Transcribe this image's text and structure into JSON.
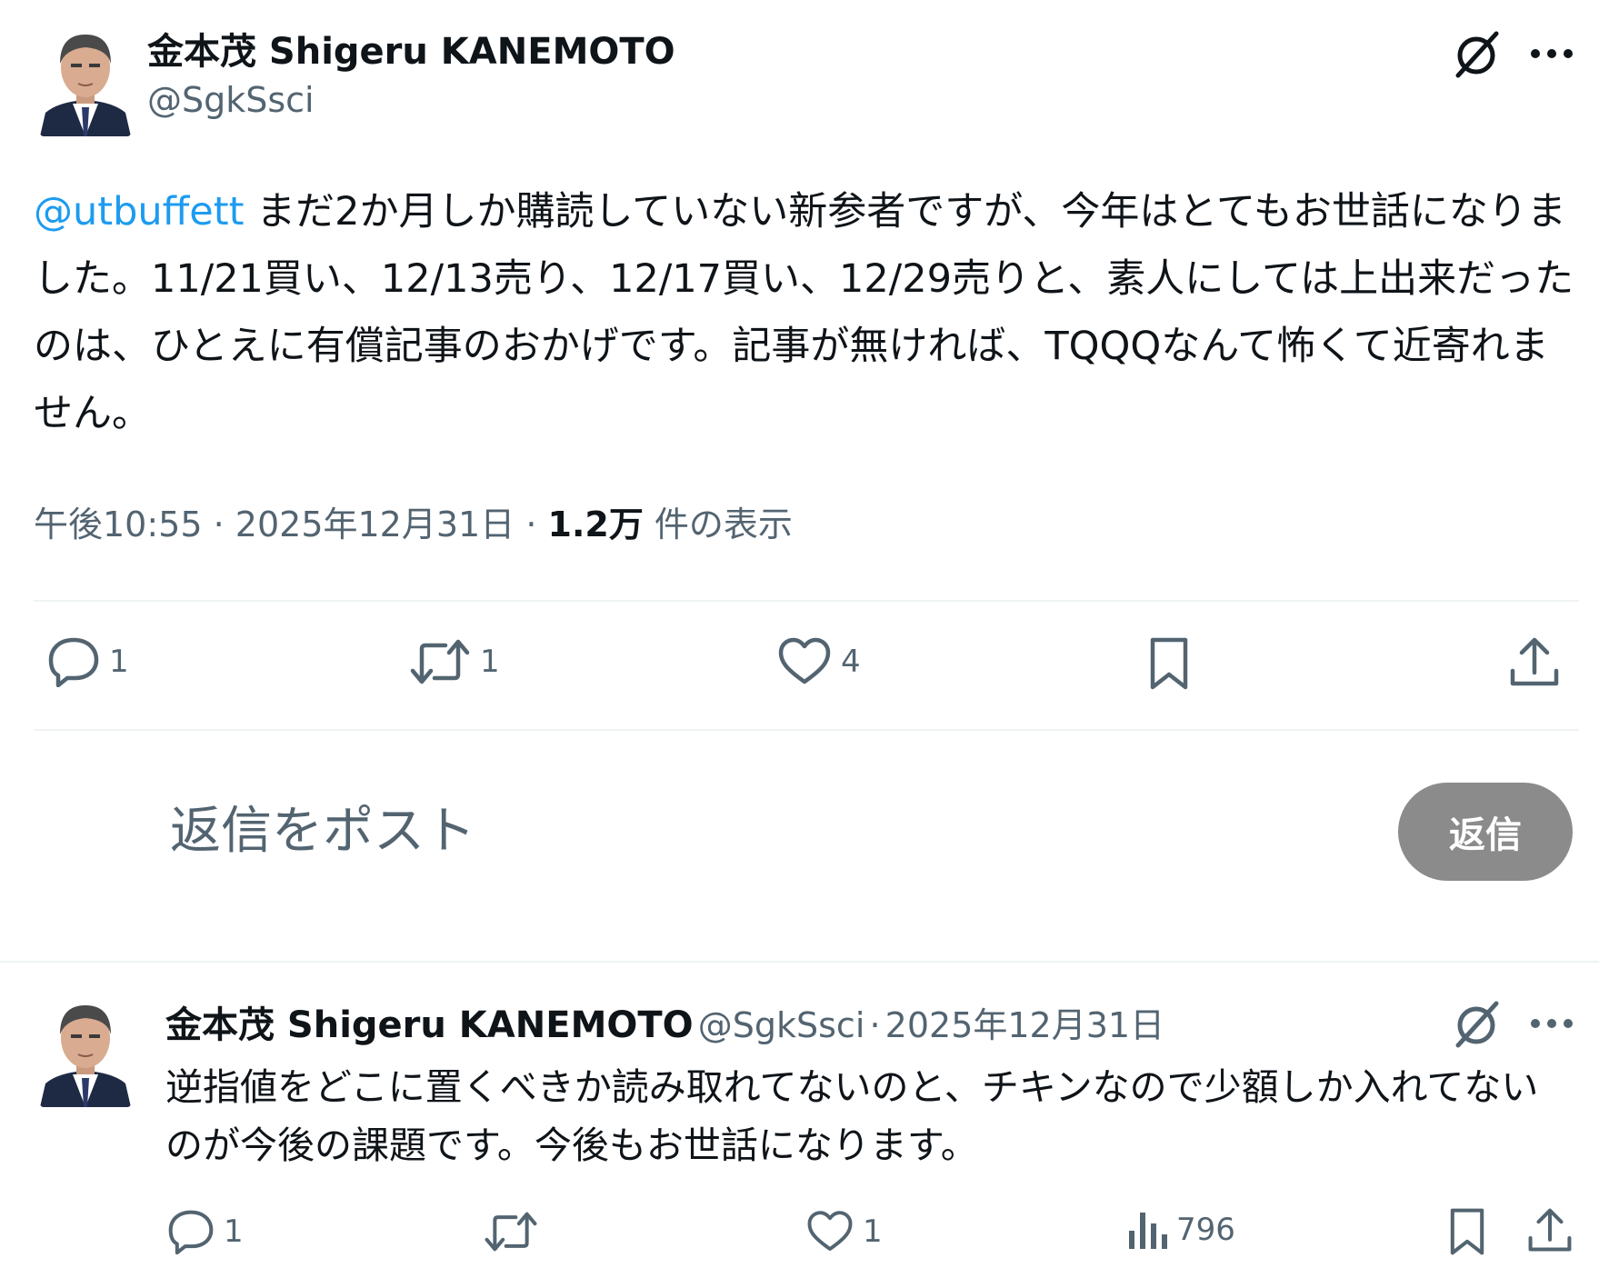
{
  "main_tweet": {
    "author_name": "金本茂 Shigeru KANEMOTO",
    "author_handle": "@SgkSsci",
    "mention": "@utbuffett",
    "text": " まだ2か月しか購読していない新参者ですが、今年はとてもお世話になりました。11/21買い、12/13売り、12/17買い、12/29売りと、素人にしては上出来だったのは、ひとえに有償記事のおかげです。記事が無ければ、TQQQなんて怖くて近寄れません。",
    "time": "午後10:55",
    "date": "2025年12月31日",
    "views_count": "1.2万",
    "views_label": "件の表示",
    "separator": "·",
    "actions": {
      "replies": "1",
      "retweets": "1",
      "likes": "4"
    }
  },
  "compose": {
    "placeholder": "返信をポスト",
    "button_label": "返信"
  },
  "reply_tweet": {
    "author_name": "金本茂 Shigeru KANEMOTO",
    "author_handle": "@SgkSsci",
    "date": "2025年12月31日",
    "separator": "·",
    "text": "逆指値をどこに置くべきか読み取れてないのと、チキンなので少額しか入れてないのが今後の課題です。今後もお世話になります。",
    "actions": {
      "replies": "1",
      "likes": "1",
      "views": "796"
    }
  },
  "icons": {
    "grok": "grok-slash-icon",
    "more": "more-dots-icon",
    "reply": "speech-bubble-icon",
    "retweet": "retweet-arrows-icon",
    "like": "heart-icon",
    "bookmark": "bookmark-icon",
    "share": "share-upload-icon",
    "views": "bar-chart-icon"
  },
  "colors": {
    "link": "#1d9bf0",
    "secondary_text": "#536471",
    "reply_button": "#8b8b8b"
  }
}
